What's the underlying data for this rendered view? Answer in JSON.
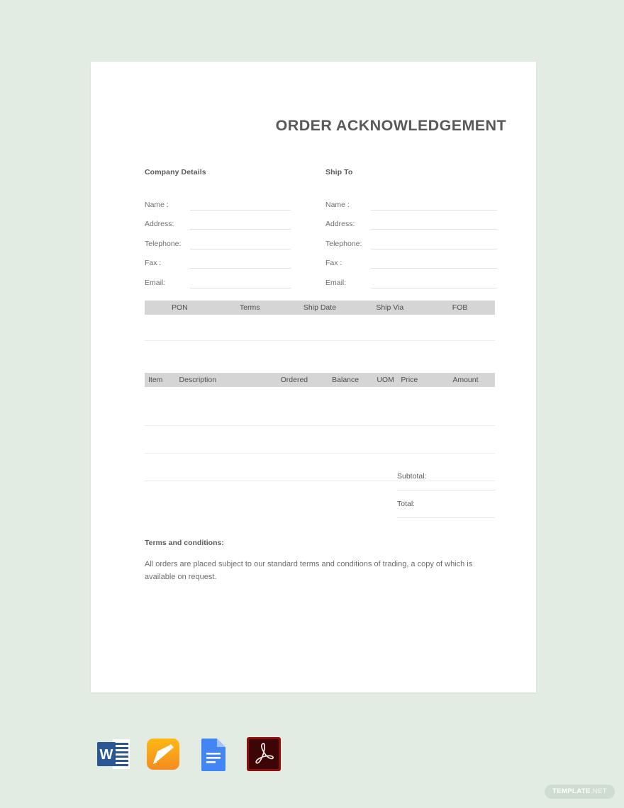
{
  "background_color": "#e2ece3",
  "document": {
    "title": "ORDER ACKNOWLEDGEMENT",
    "company_details": {
      "heading": "Company Details",
      "fields": [
        {
          "label": "Name :",
          "value": ""
        },
        {
          "label": "Address:",
          "value": ""
        },
        {
          "label": "Telephone:",
          "value": ""
        },
        {
          "label": "Fax :",
          "value": ""
        },
        {
          "label": "Email:",
          "value": ""
        }
      ]
    },
    "ship_to": {
      "heading": "Ship To",
      "fields": [
        {
          "label": "Name :",
          "value": ""
        },
        {
          "label": "Address:",
          "value": ""
        },
        {
          "label": "Telephone:",
          "value": ""
        },
        {
          "label": "Fax :",
          "value": ""
        },
        {
          "label": "Email:",
          "value": ""
        }
      ]
    },
    "order_info_table": {
      "headers": [
        "PON",
        "Terms",
        "Ship Date",
        "Ship Via",
        "FOB"
      ],
      "rows": []
    },
    "items_table": {
      "headers": [
        "Item",
        "Description",
        "Ordered",
        "Balance",
        "UOM",
        "Price",
        "Amount"
      ],
      "rows": []
    },
    "totals": [
      {
        "label": "Subtotal:",
        "value": ""
      },
      {
        "label": "Total:",
        "value": ""
      }
    ],
    "terms": {
      "title": "Terms and conditions:",
      "body": "All orders are placed subject to our standard terms and conditions of trading, a copy of which is available on request."
    }
  },
  "format_icons": [
    {
      "name": "microsoft-word-icon",
      "label": "W"
    },
    {
      "name": "apple-pages-icon",
      "label": ""
    },
    {
      "name": "google-docs-icon",
      "label": ""
    },
    {
      "name": "adobe-pdf-icon",
      "label": ""
    }
  ],
  "watermark": {
    "strong": "TEMPLATE",
    "light": ".NET"
  }
}
